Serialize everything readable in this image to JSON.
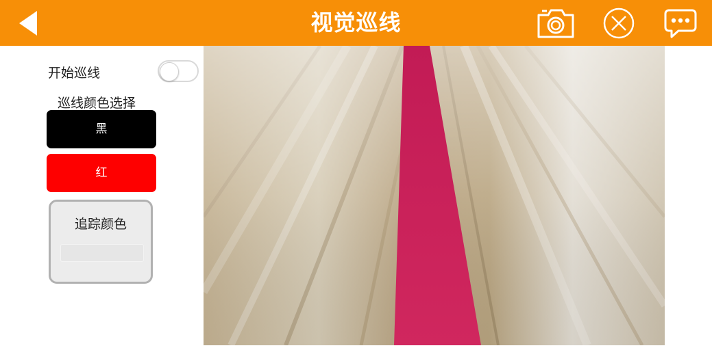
{
  "header": {
    "title": "视觉巡线",
    "background_color": "#f78f07",
    "icons": [
      "back-icon",
      "camera-icon",
      "close-icon",
      "chat-icon"
    ]
  },
  "controls": {
    "start_label": "开始巡线",
    "start_enabled": false,
    "color_select_title": "巡线颜色选择",
    "colors": [
      {
        "label": "黑",
        "color": "#000000"
      },
      {
        "label": "红",
        "color": "#fe0000"
      }
    ],
    "track_label": "追踪颜色"
  },
  "camera": {
    "line_color": "#cc1f5a",
    "floor_color": "#c9b79a"
  }
}
